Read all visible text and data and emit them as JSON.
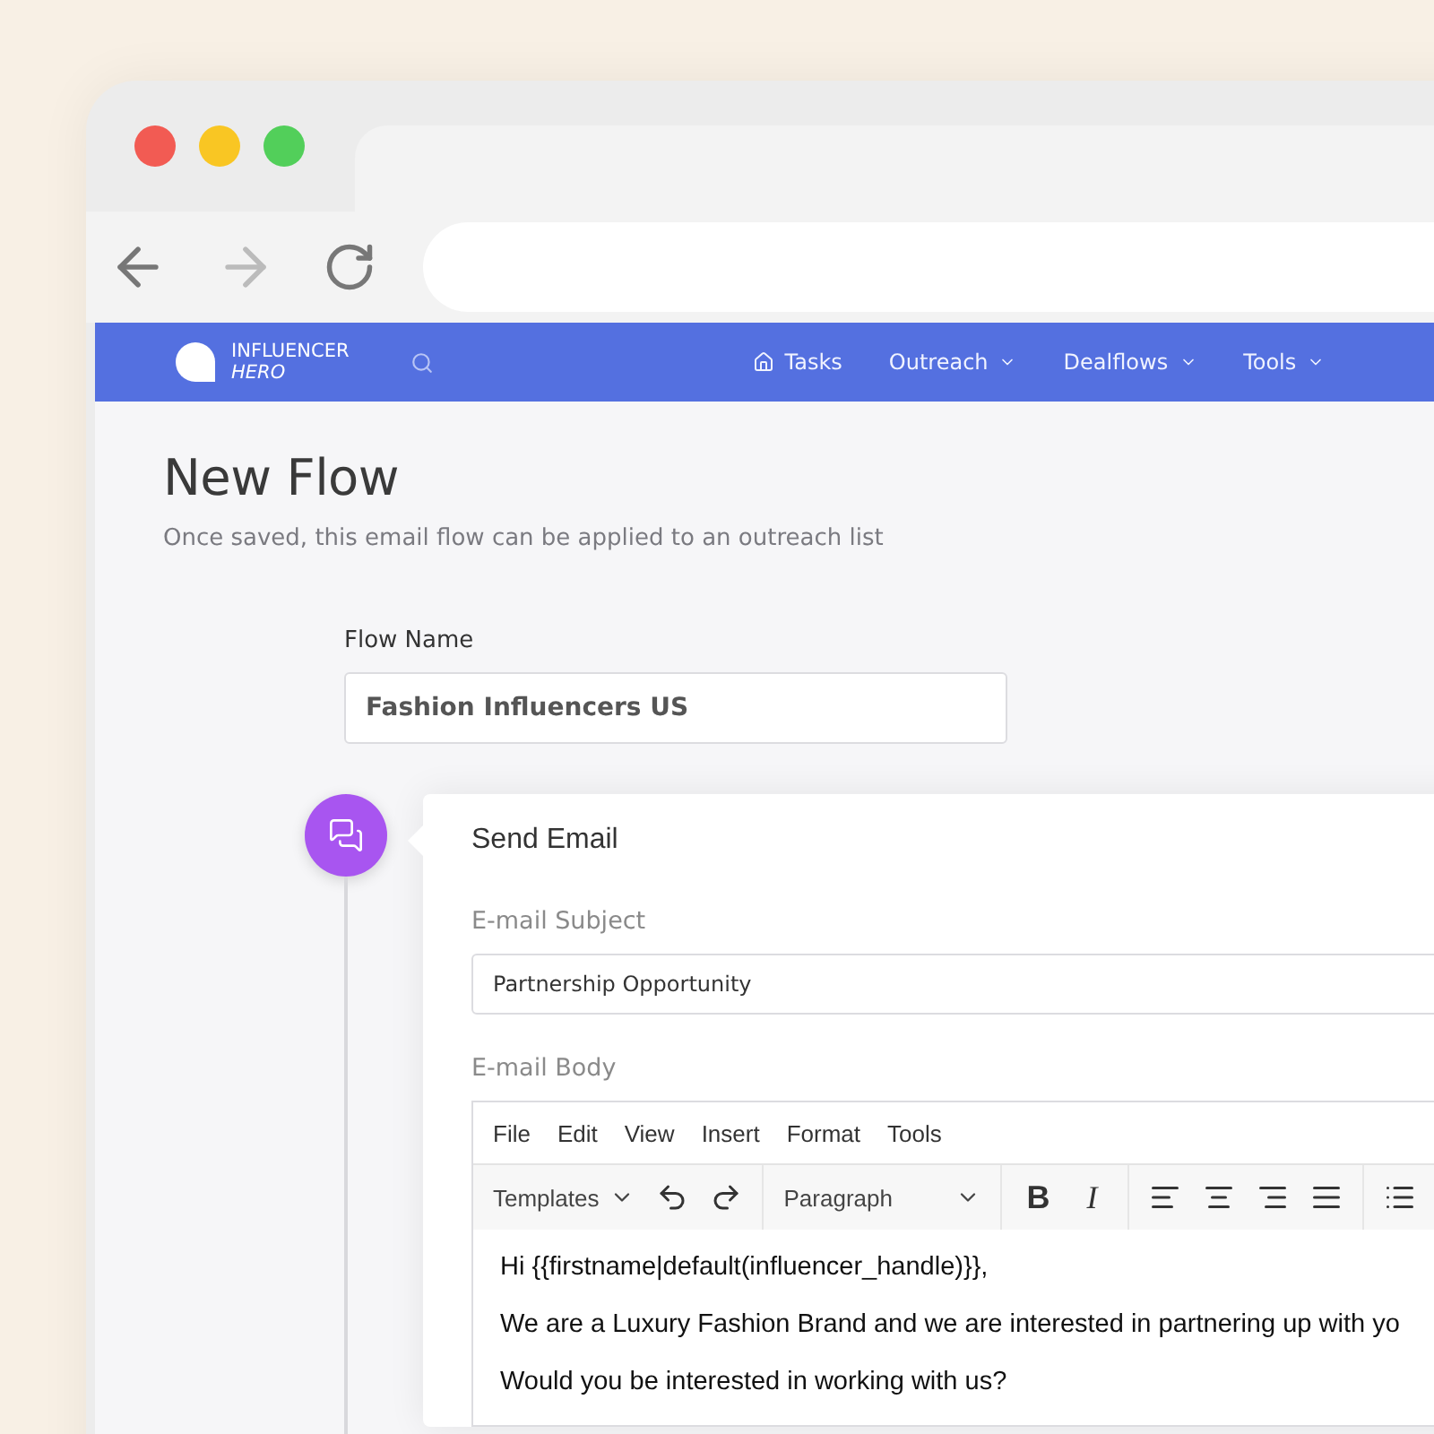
{
  "browser": {
    "traffic_lights": [
      {
        "color": "#f25b53"
      },
      {
        "color": "#f9c623"
      },
      {
        "color": "#52cf5a"
      }
    ]
  },
  "brand": {
    "line1": "INFLUENCER",
    "line2": "HERO"
  },
  "nav": [
    {
      "label": "Tasks",
      "kind": "home"
    },
    {
      "label": "Outreach",
      "kind": "dropdown"
    },
    {
      "label": "Dealflows",
      "kind": "dropdown"
    },
    {
      "label": "Tools",
      "kind": "dropdown"
    }
  ],
  "page": {
    "title": "New Flow",
    "subtitle": "Once saved, this email flow can be applied to an outreach list"
  },
  "flow_name": {
    "label": "Flow Name",
    "value": "Fashion Influencers US"
  },
  "step": {
    "title": "Send Email",
    "subject_label": "E-mail Subject",
    "subject_value": "Partnership Opportunity",
    "body_label": "E-mail Body"
  },
  "editor": {
    "menu": [
      "File",
      "Edit",
      "View",
      "Insert",
      "Format",
      "Tools"
    ],
    "templates": "Templates",
    "block_format": "Paragraph",
    "bold": "B",
    "italic": "I",
    "paragraphs": [
      "Hi {{firstname|default(influencer_handle)}},",
      "We are a Luxury Fashion Brand and we are interested in partnering up with yo",
      "Would you be interested in working with us?"
    ]
  }
}
